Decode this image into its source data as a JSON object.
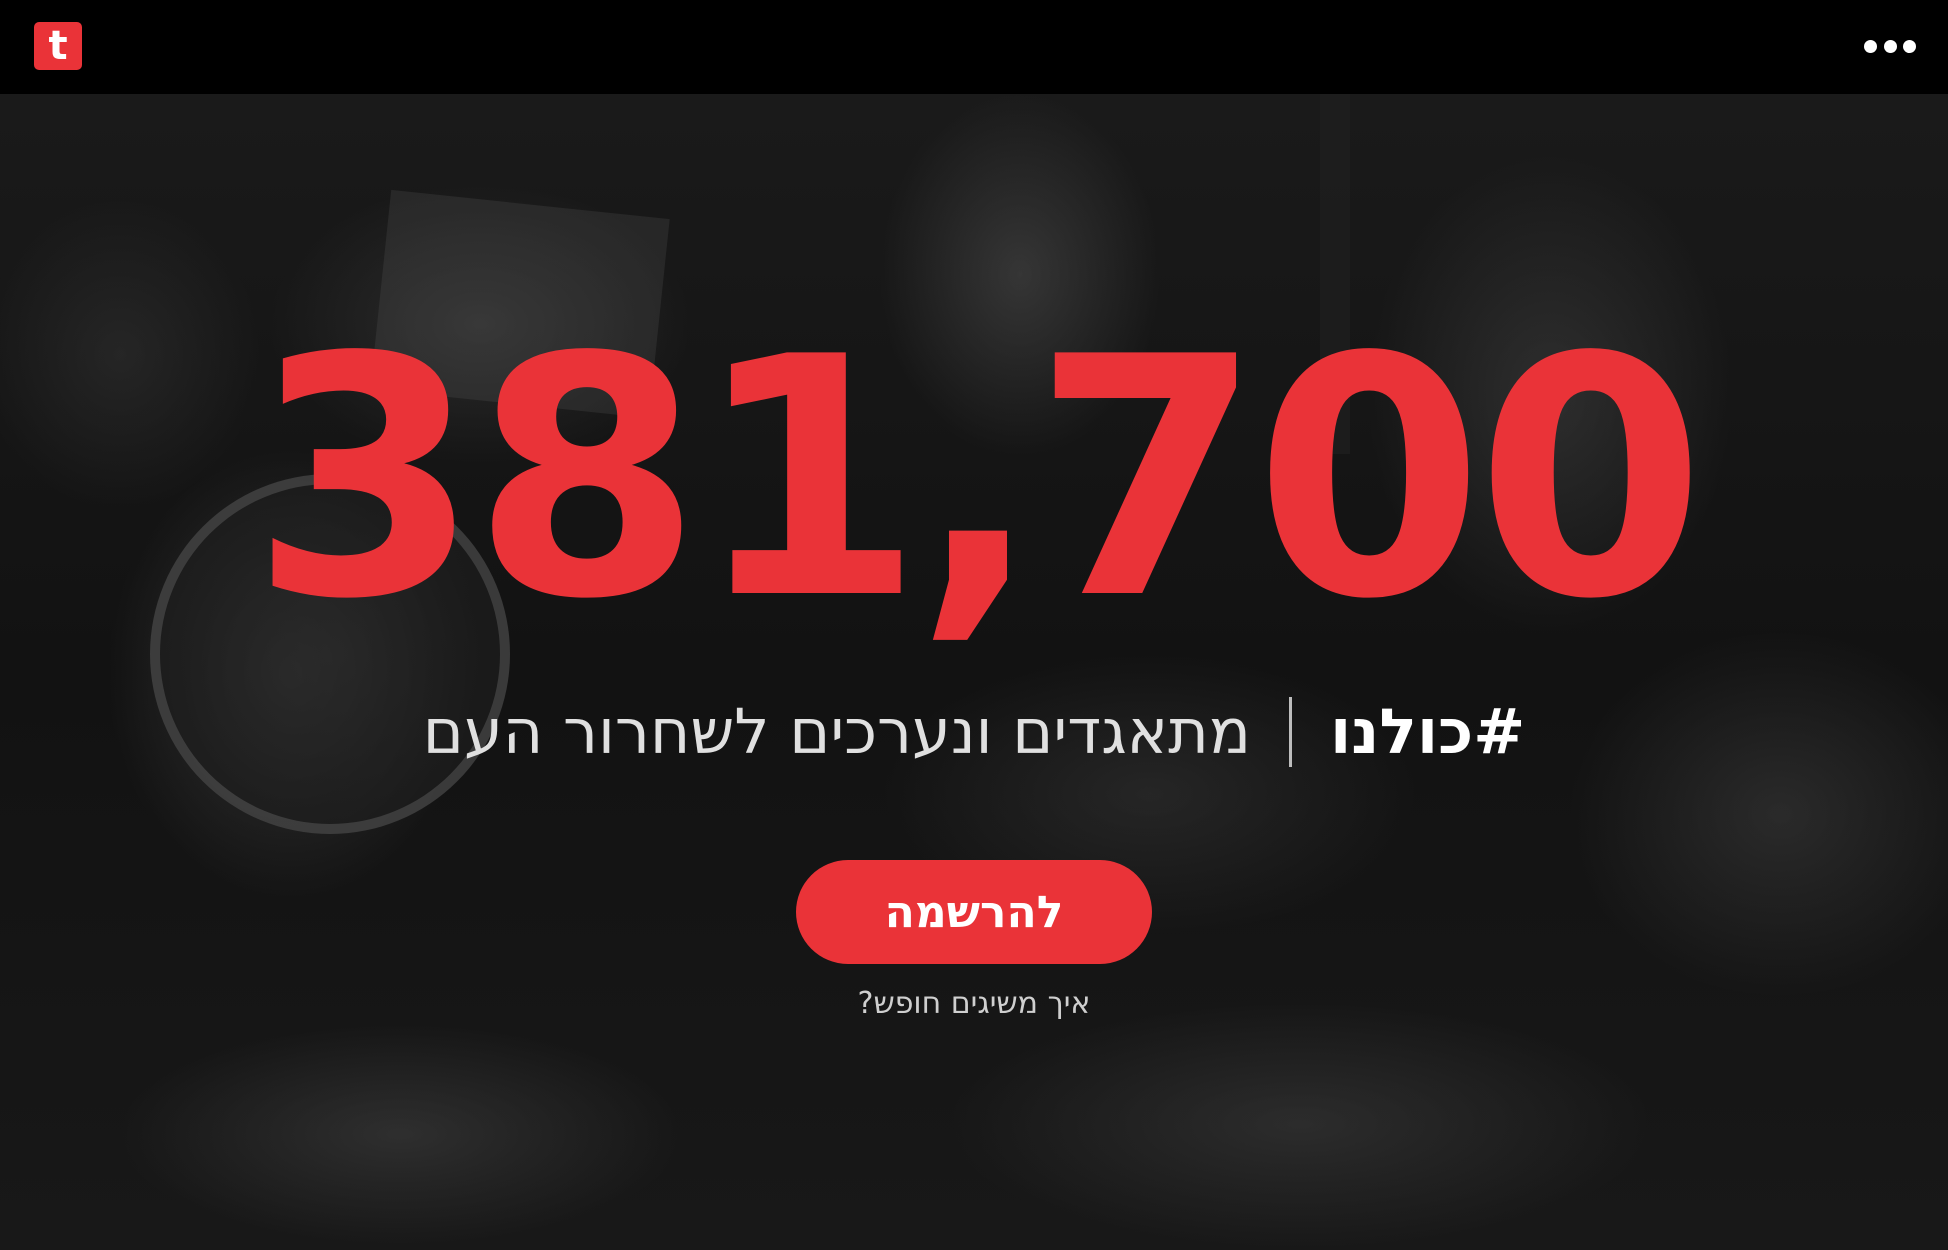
{
  "header": {
    "logo_letter": "t",
    "menu_icon": "more-horizontal-icon",
    "accent_color": "#ea3338"
  },
  "hero": {
    "counter": "381,700",
    "hashtag": "#כולנו",
    "description": "מתאגדים ונערכים לשחרור העם",
    "cta_label": "להרשמה",
    "howto_link": "איך משיגים חופש?"
  }
}
